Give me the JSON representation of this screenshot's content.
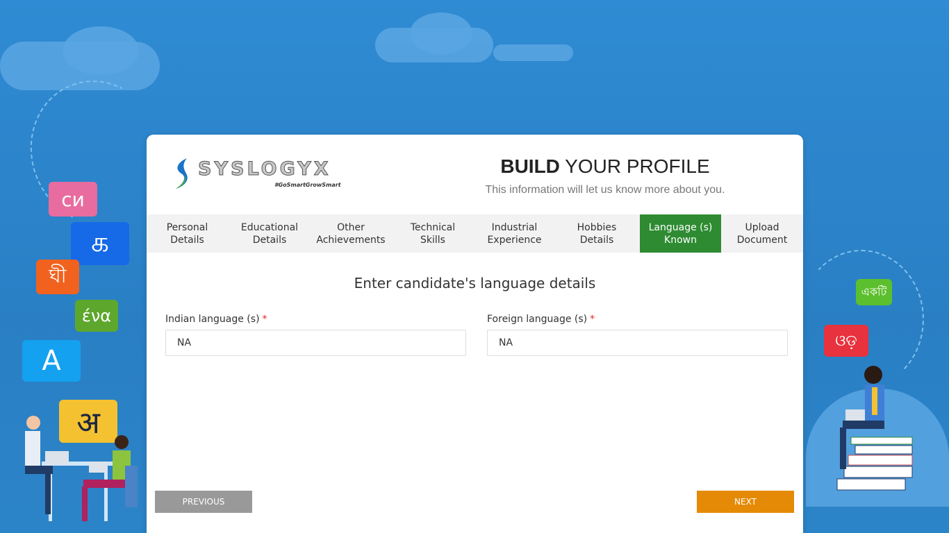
{
  "brand": {
    "name": "SYSLOGYX",
    "tagline": "#GoSmartGrowSmart"
  },
  "header": {
    "title_bold": "BUILD",
    "title_rest": " YOUR PROFILE",
    "subtitle": "This information will let us know more about you."
  },
  "tabs": [
    {
      "label": "Personal\nDetails",
      "active": false
    },
    {
      "label": "Educational\nDetails",
      "active": false
    },
    {
      "label": "Other\nAchievements",
      "active": false
    },
    {
      "label": "Technical\nSkills",
      "active": false
    },
    {
      "label": "Industrial\nExperience",
      "active": false
    },
    {
      "label": "Hobbies\nDetails",
      "active": false
    },
    {
      "label": "Language (s)\nKnown",
      "active": true
    },
    {
      "label": "Upload\nDocument",
      "active": false
    }
  ],
  "form": {
    "title": "Enter candidate's language details",
    "indian_label": "Indian language (s)",
    "indian_value": "NA",
    "foreign_label": "Foreign language (s)",
    "foreign_value": "NA",
    "required_mark": "*"
  },
  "buttons": {
    "previous": "PREVIOUS",
    "next": "NEXT"
  },
  "decor": {
    "bubbles": [
      "си",
      "க",
      "ঘী",
      "ένα",
      "A",
      "अ",
      "একটি",
      "ଓଡ଼"
    ]
  },
  "colors": {
    "active_tab": "#2e8b32",
    "next_button": "#e58a07",
    "previous_button": "#999999",
    "background": "#2f8bd3"
  }
}
